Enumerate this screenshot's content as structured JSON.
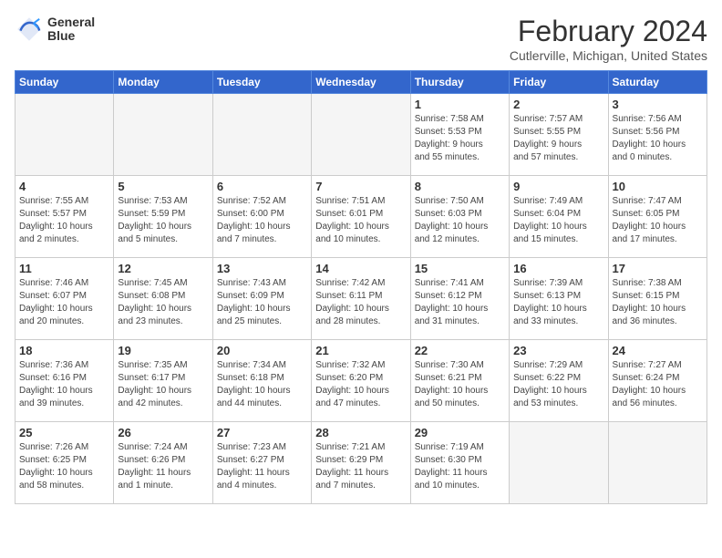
{
  "header": {
    "logo_line1": "General",
    "logo_line2": "Blue",
    "month": "February 2024",
    "location": "Cutlerville, Michigan, United States"
  },
  "weekdays": [
    "Sunday",
    "Monday",
    "Tuesday",
    "Wednesday",
    "Thursday",
    "Friday",
    "Saturday"
  ],
  "weeks": [
    [
      {
        "day": "",
        "info": ""
      },
      {
        "day": "",
        "info": ""
      },
      {
        "day": "",
        "info": ""
      },
      {
        "day": "",
        "info": ""
      },
      {
        "day": "1",
        "info": "Sunrise: 7:58 AM\nSunset: 5:53 PM\nDaylight: 9 hours\nand 55 minutes."
      },
      {
        "day": "2",
        "info": "Sunrise: 7:57 AM\nSunset: 5:55 PM\nDaylight: 9 hours\nand 57 minutes."
      },
      {
        "day": "3",
        "info": "Sunrise: 7:56 AM\nSunset: 5:56 PM\nDaylight: 10 hours\nand 0 minutes."
      }
    ],
    [
      {
        "day": "4",
        "info": "Sunrise: 7:55 AM\nSunset: 5:57 PM\nDaylight: 10 hours\nand 2 minutes."
      },
      {
        "day": "5",
        "info": "Sunrise: 7:53 AM\nSunset: 5:59 PM\nDaylight: 10 hours\nand 5 minutes."
      },
      {
        "day": "6",
        "info": "Sunrise: 7:52 AM\nSunset: 6:00 PM\nDaylight: 10 hours\nand 7 minutes."
      },
      {
        "day": "7",
        "info": "Sunrise: 7:51 AM\nSunset: 6:01 PM\nDaylight: 10 hours\nand 10 minutes."
      },
      {
        "day": "8",
        "info": "Sunrise: 7:50 AM\nSunset: 6:03 PM\nDaylight: 10 hours\nand 12 minutes."
      },
      {
        "day": "9",
        "info": "Sunrise: 7:49 AM\nSunset: 6:04 PM\nDaylight: 10 hours\nand 15 minutes."
      },
      {
        "day": "10",
        "info": "Sunrise: 7:47 AM\nSunset: 6:05 PM\nDaylight: 10 hours\nand 17 minutes."
      }
    ],
    [
      {
        "day": "11",
        "info": "Sunrise: 7:46 AM\nSunset: 6:07 PM\nDaylight: 10 hours\nand 20 minutes."
      },
      {
        "day": "12",
        "info": "Sunrise: 7:45 AM\nSunset: 6:08 PM\nDaylight: 10 hours\nand 23 minutes."
      },
      {
        "day": "13",
        "info": "Sunrise: 7:43 AM\nSunset: 6:09 PM\nDaylight: 10 hours\nand 25 minutes."
      },
      {
        "day": "14",
        "info": "Sunrise: 7:42 AM\nSunset: 6:11 PM\nDaylight: 10 hours\nand 28 minutes."
      },
      {
        "day": "15",
        "info": "Sunrise: 7:41 AM\nSunset: 6:12 PM\nDaylight: 10 hours\nand 31 minutes."
      },
      {
        "day": "16",
        "info": "Sunrise: 7:39 AM\nSunset: 6:13 PM\nDaylight: 10 hours\nand 33 minutes."
      },
      {
        "day": "17",
        "info": "Sunrise: 7:38 AM\nSunset: 6:15 PM\nDaylight: 10 hours\nand 36 minutes."
      }
    ],
    [
      {
        "day": "18",
        "info": "Sunrise: 7:36 AM\nSunset: 6:16 PM\nDaylight: 10 hours\nand 39 minutes."
      },
      {
        "day": "19",
        "info": "Sunrise: 7:35 AM\nSunset: 6:17 PM\nDaylight: 10 hours\nand 42 minutes."
      },
      {
        "day": "20",
        "info": "Sunrise: 7:34 AM\nSunset: 6:18 PM\nDaylight: 10 hours\nand 44 minutes."
      },
      {
        "day": "21",
        "info": "Sunrise: 7:32 AM\nSunset: 6:20 PM\nDaylight: 10 hours\nand 47 minutes."
      },
      {
        "day": "22",
        "info": "Sunrise: 7:30 AM\nSunset: 6:21 PM\nDaylight: 10 hours\nand 50 minutes."
      },
      {
        "day": "23",
        "info": "Sunrise: 7:29 AM\nSunset: 6:22 PM\nDaylight: 10 hours\nand 53 minutes."
      },
      {
        "day": "24",
        "info": "Sunrise: 7:27 AM\nSunset: 6:24 PM\nDaylight: 10 hours\nand 56 minutes."
      }
    ],
    [
      {
        "day": "25",
        "info": "Sunrise: 7:26 AM\nSunset: 6:25 PM\nDaylight: 10 hours\nand 58 minutes."
      },
      {
        "day": "26",
        "info": "Sunrise: 7:24 AM\nSunset: 6:26 PM\nDaylight: 11 hours\nand 1 minute."
      },
      {
        "day": "27",
        "info": "Sunrise: 7:23 AM\nSunset: 6:27 PM\nDaylight: 11 hours\nand 4 minutes."
      },
      {
        "day": "28",
        "info": "Sunrise: 7:21 AM\nSunset: 6:29 PM\nDaylight: 11 hours\nand 7 minutes."
      },
      {
        "day": "29",
        "info": "Sunrise: 7:19 AM\nSunset: 6:30 PM\nDaylight: 11 hours\nand 10 minutes."
      },
      {
        "day": "",
        "info": ""
      },
      {
        "day": "",
        "info": ""
      }
    ]
  ]
}
